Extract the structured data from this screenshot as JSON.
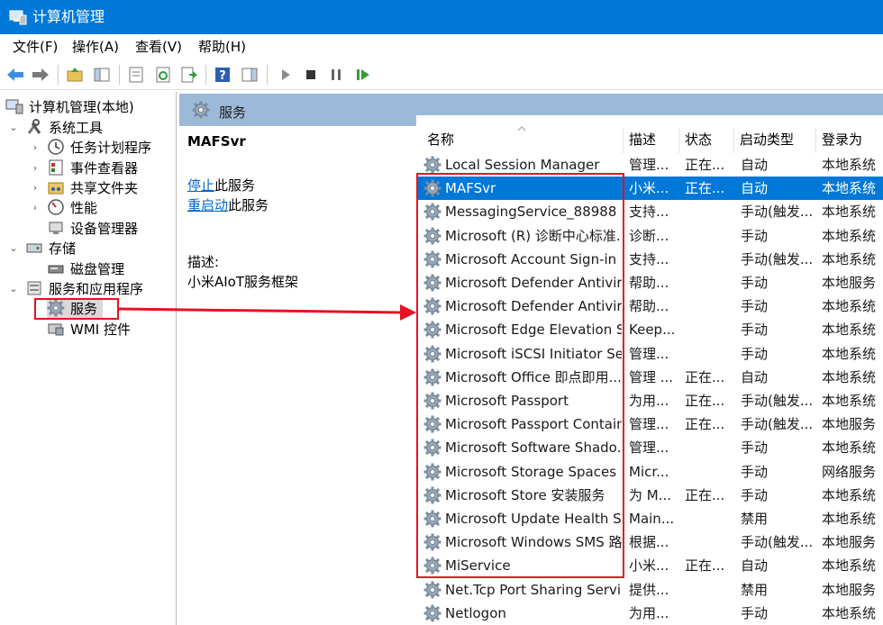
{
  "window": {
    "title": "计算机管理"
  },
  "menu": [
    "文件(F)",
    "操作(A)",
    "查看(V)",
    "帮助(H)"
  ],
  "tree": {
    "root": "计算机管理(本地)",
    "system_tools": "系统工具",
    "task_scheduler": "任务计划程序",
    "event_viewer": "事件查看器",
    "shared_folders": "共享文件夹",
    "performance": "性能",
    "device_manager": "设备管理器",
    "storage": "存储",
    "disk_management": "磁盘管理",
    "services_apps": "服务和应用程序",
    "services": "服务",
    "wmi": "WMI 控件"
  },
  "header": {
    "title": "服务"
  },
  "detail": {
    "service_name": "MAFSvr",
    "stop_link": "停止",
    "stop_suffix": "此服务",
    "restart_link": "重启动",
    "restart_suffix": "此服务",
    "desc_label": "描述:",
    "desc_text": "小米AIoT服务框架"
  },
  "columns": {
    "name": "名称",
    "desc": "描述",
    "status": "状态",
    "startup": "启动类型",
    "logon": "登录为"
  },
  "rows": [
    {
      "name": "Local Session Manager",
      "desc": "管理...",
      "status": "正在...",
      "startup": "自动",
      "logon": "本地系统"
    },
    {
      "name": "MAFSvr",
      "desc": "小米...",
      "status": "正在...",
      "startup": "自动",
      "logon": "本地系统"
    },
    {
      "name": "MessagingService_88988",
      "desc": "支持...",
      "status": "",
      "startup": "手动(触发...",
      "logon": "本地系统"
    },
    {
      "name": "Microsoft (R) 诊断中心标准...",
      "desc": "诊断...",
      "status": "",
      "startup": "手动",
      "logon": "本地系统"
    },
    {
      "name": "Microsoft Account Sign-in ...",
      "desc": "支持...",
      "status": "",
      "startup": "手动(触发...",
      "logon": "本地系统"
    },
    {
      "name": "Microsoft Defender Antivir...",
      "desc": "帮助...",
      "status": "",
      "startup": "手动",
      "logon": "本地服务"
    },
    {
      "name": "Microsoft Defender Antivir...",
      "desc": "帮助...",
      "status": "",
      "startup": "手动",
      "logon": "本地系统"
    },
    {
      "name": "Microsoft Edge Elevation S...",
      "desc": "Keep...",
      "status": "",
      "startup": "手动",
      "logon": "本地系统"
    },
    {
      "name": "Microsoft iSCSI Initiator Ser...",
      "desc": "管理...",
      "status": "",
      "startup": "手动",
      "logon": "本地系统"
    },
    {
      "name": "Microsoft Office 即点即用...",
      "desc": "管理 ...",
      "status": "正在...",
      "startup": "自动",
      "logon": "本地系统"
    },
    {
      "name": "Microsoft Passport",
      "desc": "为用...",
      "status": "正在...",
      "startup": "手动(触发...",
      "logon": "本地系统"
    },
    {
      "name": "Microsoft Passport Container",
      "desc": "管理...",
      "status": "正在...",
      "startup": "手动(触发...",
      "logon": "本地服务"
    },
    {
      "name": "Microsoft Software Shado...",
      "desc": "管理...",
      "status": "",
      "startup": "手动",
      "logon": "本地系统"
    },
    {
      "name": "Microsoft Storage Spaces S...",
      "desc": "Micr...",
      "status": "",
      "startup": "手动",
      "logon": "网络服务"
    },
    {
      "name": "Microsoft Store 安装服务",
      "desc": "为 M...",
      "status": "正在...",
      "startup": "手动",
      "logon": "本地系统"
    },
    {
      "name": "Microsoft Update Health S...",
      "desc": "Main...",
      "status": "",
      "startup": "禁用",
      "logon": "本地系统"
    },
    {
      "name": "Microsoft Windows SMS 路...",
      "desc": "根据...",
      "status": "",
      "startup": "手动(触发...",
      "logon": "本地服务"
    },
    {
      "name": "MiService",
      "desc": "小米...",
      "status": "正在...",
      "startup": "自动",
      "logon": "本地系统"
    },
    {
      "name": "Net.Tcp Port Sharing Service",
      "desc": "提供...",
      "status": "",
      "startup": "禁用",
      "logon": "本地服务"
    },
    {
      "name": "Netlogon",
      "desc": "为用...",
      "status": "",
      "startup": "手动",
      "logon": "本地系统"
    }
  ],
  "icons": {
    "gear": "gear-icon",
    "back": "back-arrow-icon",
    "forward": "forward-arrow-icon",
    "play": "play-icon",
    "stop": "stop-icon",
    "pause": "pause-icon",
    "restart": "restart-icon"
  },
  "colors": {
    "titlebar": "#0078d7",
    "selection": "#0078d7",
    "annotation": "#e81123",
    "header_band": "#9db9d8"
  }
}
